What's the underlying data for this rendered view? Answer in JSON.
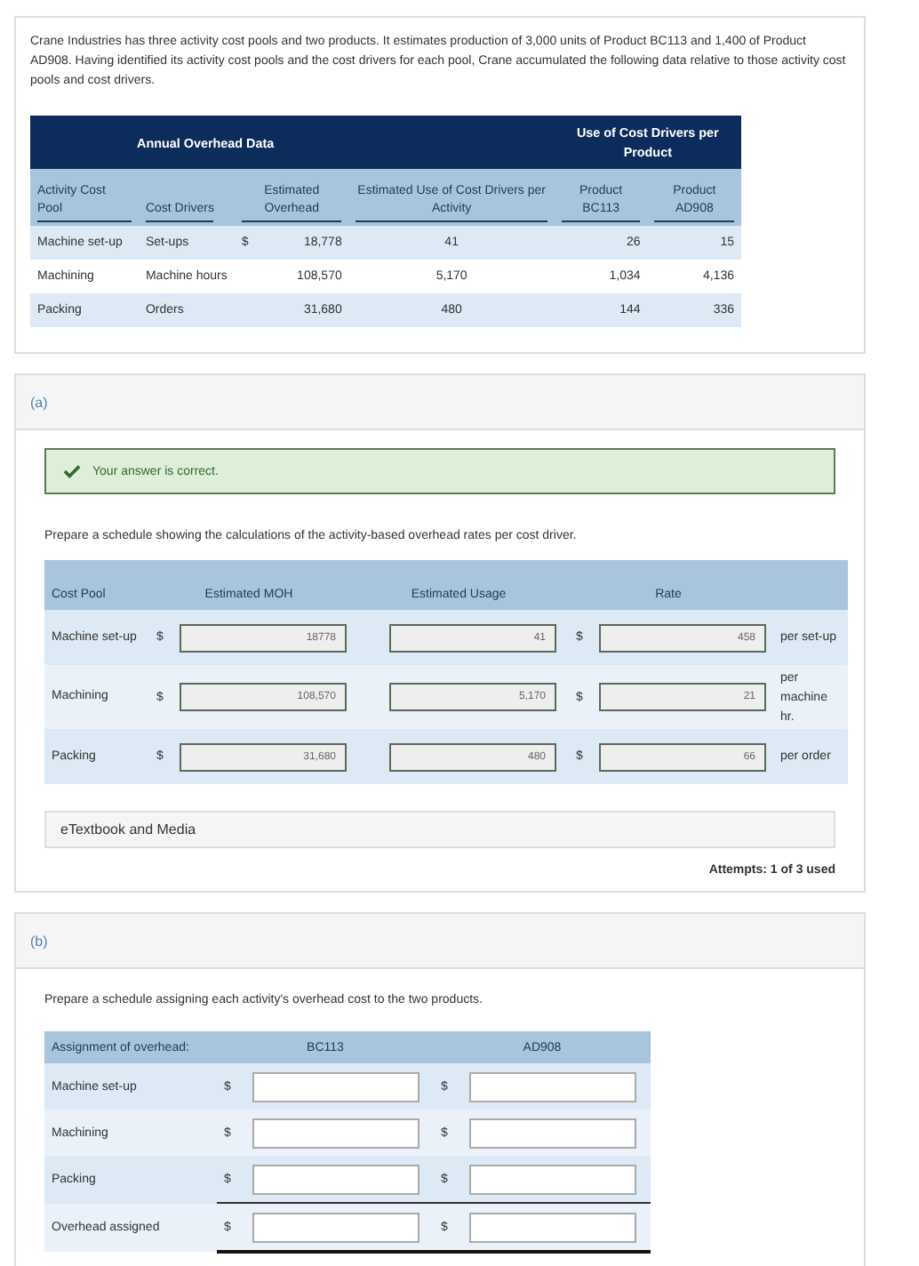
{
  "intro": "Crane Industries has three activity cost pools and two products. It estimates production of 3,000 units of Product BC113 and 1,400 of Product AD908. Having identified its activity cost pools and the cost drivers for each pool, Crane accumulated the following data relative to those activity cost pools and cost drivers.",
  "data_table": {
    "group_left": "Annual Overhead Data",
    "group_right": "Use of Cost Drivers per Product",
    "columns": [
      "Activity Cost Pool",
      "Cost Drivers",
      "Estimated Overhead",
      "Estimated Use of Cost Drivers per Activity",
      "Product BC113",
      "Product AD908"
    ],
    "rows": [
      {
        "pool": "Machine set-up",
        "driver": "Set-ups",
        "currency": "$",
        "overhead": "18,778",
        "use": "41",
        "bc113": "26",
        "ad908": "15"
      },
      {
        "pool": "Machining",
        "driver": "Machine hours",
        "overhead": "108,570",
        "use": "5,170",
        "bc113": "1,034",
        "ad908": "4,136"
      },
      {
        "pool": "Packing",
        "driver": "Orders",
        "overhead": "31,680",
        "use": "480",
        "bc113": "144",
        "ad908": "336"
      }
    ]
  },
  "part_a": {
    "label": "(a)",
    "feedback": {
      "correct": true,
      "text": "Your answer is correct."
    },
    "instruction": "Prepare a schedule showing the calculations of the activity-based overhead rates per cost driver.",
    "columns": [
      "Cost Pool",
      "Estimated MOH",
      "Estimated Usage",
      "Rate"
    ],
    "rows": [
      {
        "pool": "Machine set-up",
        "moh_currency": "$",
        "moh": "18778",
        "usage": "41",
        "rate_currency": "$",
        "rate": "458",
        "unit": "per set-up"
      },
      {
        "pool": "Machining",
        "moh_currency": "$",
        "moh": "108,570",
        "usage": "5,170",
        "rate_currency": "$",
        "rate": "21",
        "unit": "per machine hr."
      },
      {
        "pool": "Packing",
        "moh_currency": "$",
        "moh": "31,680",
        "usage": "480",
        "rate_currency": "$",
        "rate": "66",
        "unit": "per order"
      }
    ],
    "etextbook": "eTextbook and Media",
    "attempts": "Attempts: 1 of 3 used"
  },
  "part_b": {
    "label": "(b)",
    "instruction": "Prepare a schedule assigning each activity's overhead cost to the two products.",
    "columns": [
      "Assignment of overhead:",
      "BC113",
      "AD908"
    ],
    "rows": [
      {
        "label": "Machine set-up",
        "kind": "item",
        "currency_1": "$",
        "currency_2": "$"
      },
      {
        "label": "Machining",
        "kind": "item",
        "currency_1": "$",
        "currency_2": "$"
      },
      {
        "label": "Packing",
        "kind": "item",
        "currency_1": "$",
        "currency_2": "$"
      },
      {
        "label": "Overhead assigned",
        "kind": "total",
        "currency_1": "$",
        "currency_2": "$"
      }
    ]
  }
}
